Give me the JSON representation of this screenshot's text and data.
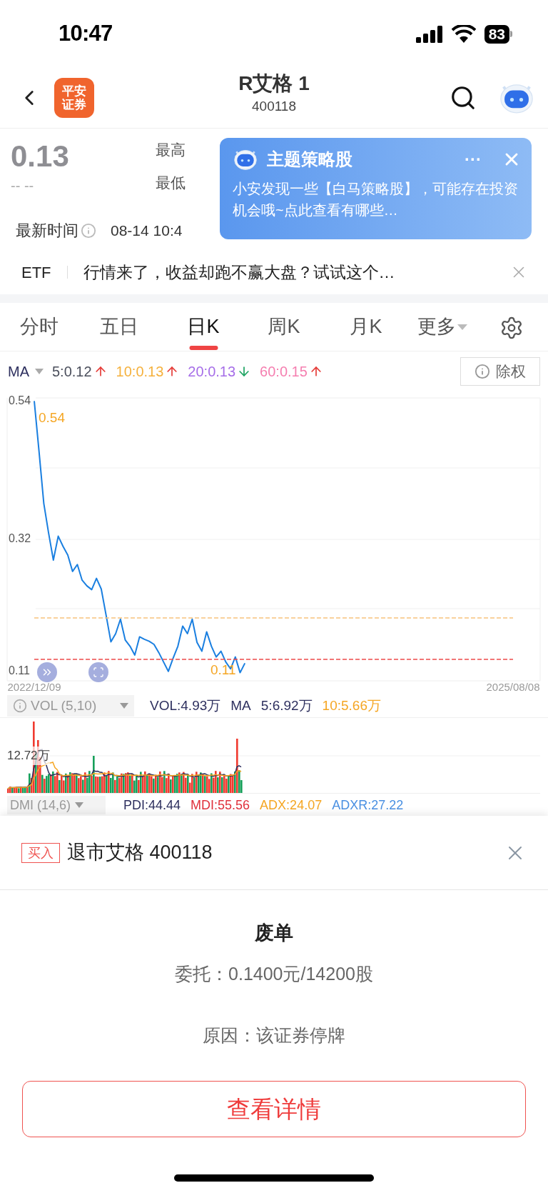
{
  "status_bar": {
    "time": "10:47",
    "battery": "83"
  },
  "header": {
    "logo_lines": [
      "平安",
      "证券"
    ],
    "title": "R艾格 1",
    "code": "400118"
  },
  "quote": {
    "price": "0.13",
    "change": "-- --",
    "labels": [
      "最高",
      "最低"
    ],
    "time_label": "最新时间",
    "time_value": "08-14 10:4"
  },
  "popup": {
    "title": "主题策略股",
    "more": "···",
    "body": "小安发现一些【白马策略股】，可能存在投资机会哦~点此查看有哪些…"
  },
  "ad": {
    "tag": "ETF",
    "text": "行情来了，收益却跑不赢大盘？试试这个…"
  },
  "tabs": [
    {
      "label": "分时",
      "selected": false
    },
    {
      "label": "五日",
      "selected": false
    },
    {
      "label": "日K",
      "selected": true
    },
    {
      "label": "周K",
      "selected": false
    },
    {
      "label": "月K",
      "selected": false
    },
    {
      "label": "更多",
      "selected": false,
      "kind": "dropdown"
    }
  ],
  "ma": {
    "label": "MA",
    "button": "除权",
    "items": [
      {
        "text": "5:0.12",
        "color": "#4b4f5c",
        "kind": "up"
      },
      {
        "text": "10:0.13",
        "color": "#f5b13d",
        "kind": "up"
      },
      {
        "text": "20:0.13",
        "color": "#a66ee8",
        "kind": "down"
      },
      {
        "text": "60:0.15",
        "color": "#f57fb0",
        "kind": "up"
      }
    ]
  },
  "chart": {
    "chart_data": {
      "type": "line",
      "ylim": [
        0.095,
        0.545
      ],
      "yticks": [
        {
          "value": 0.54,
          "label": "0.54"
        },
        {
          "value": 0.32,
          "label": "0.32"
        },
        {
          "value": 0.11,
          "label": "0.11"
        }
      ],
      "categories": [
        "2022/12/09",
        null,
        null,
        null,
        null,
        null,
        null,
        null,
        null,
        null,
        null,
        null,
        null,
        null,
        null,
        null,
        null,
        null,
        null,
        null,
        null,
        null,
        null,
        null,
        null,
        null,
        null,
        null,
        null,
        null,
        null,
        null,
        null,
        null,
        null,
        null,
        null,
        null,
        null,
        null,
        null,
        null,
        null,
        null,
        null,
        null,
        null,
        null,
        null,
        null,
        null,
        null,
        null,
        null,
        null,
        null,
        null,
        null,
        null,
        null,
        null,
        null,
        null,
        null,
        null,
        null,
        null,
        null,
        null,
        null,
        null,
        null,
        null,
        null,
        null,
        null,
        null,
        null,
        null,
        null,
        null,
        null,
        null,
        null,
        null,
        null,
        null,
        null,
        null,
        null,
        null,
        null,
        null,
        null,
        null,
        null,
        null,
        null,
        null,
        null,
        "2025/08/08"
      ],
      "series": [
        {
          "color": "#1a7fe0",
          "values": [
            0.54,
            0.46,
            0.377,
            0.33,
            0.287,
            0.325,
            0.309,
            0.295,
            0.269,
            0.28,
            0.255,
            0.246,
            0.24,
            0.258,
            0.241,
            0.2,
            0.157,
            0.17,
            0.193,
            0.16,
            0.15,
            0.136,
            0.165,
            0.161,
            0.158,
            0.153,
            0.14,
            0.125,
            0.11,
            0.131,
            0.15,
            0.182,
            0.17,
            0.193,
            0.156,
            0.142,
            0.173,
            0.15,
            0.133,
            0.142,
            0.125,
            0.114,
            0.133,
            0.108,
            0.123,
            null,
            null,
            null,
            null,
            null,
            null,
            null,
            null,
            null,
            null,
            null,
            null,
            null,
            null,
            null,
            null,
            null,
            null,
            null,
            null,
            null,
            null,
            null,
            null,
            null,
            null,
            null,
            null,
            null,
            null,
            null,
            null,
            null,
            null,
            null,
            null,
            null,
            null,
            null,
            null,
            null,
            null,
            null,
            null,
            null,
            null,
            null,
            null,
            null,
            null,
            null,
            null,
            null,
            null,
            null,
            null
          ]
        },
        {
          "color": "#f8c47e",
          "line_style": "dashed",
          "values": [
            0.195,
            0.195,
            0.195,
            0.195,
            0.195,
            0.195,
            0.195,
            0.195,
            0.195,
            0.195,
            0.195,
            0.195,
            0.195,
            0.195,
            0.195,
            0.195,
            0.195,
            0.195,
            0.195,
            0.195,
            0.195,
            0.195,
            0.195,
            0.195,
            0.195,
            0.195,
            0.195,
            0.195,
            0.195,
            0.195,
            0.195,
            0.195,
            0.195,
            0.195,
            0.195,
            0.195,
            0.195,
            0.195,
            0.195,
            0.195,
            0.195,
            0.195,
            0.195,
            0.195,
            0.195,
            0.195,
            0.195,
            0.195,
            0.195,
            0.195,
            0.195,
            0.195,
            0.195,
            0.195,
            0.195,
            0.195,
            0.195,
            0.195,
            0.195,
            0.195,
            0.195,
            0.195,
            0.195,
            0.195,
            0.195,
            0.195,
            0.195,
            0.195,
            0.195,
            0.195,
            0.195,
            0.195,
            0.195,
            0.195,
            0.195,
            0.195,
            0.195,
            0.195,
            0.195,
            0.195,
            0.195,
            0.195,
            0.195,
            0.195,
            0.195,
            0.195,
            0.195,
            0.195,
            0.195,
            0.195,
            0.195,
            0.195,
            0.195,
            0.195,
            0.195,
            0.195,
            0.195,
            0.195,
            0.195,
            0.195,
            0.195
          ]
        },
        {
          "color": "#ee4b4b",
          "line_style": "dashed",
          "values": [
            0.129,
            0.129,
            0.129,
            0.129,
            0.129,
            0.129,
            0.129,
            0.129,
            0.129,
            0.129,
            0.129,
            0.129,
            0.129,
            0.129,
            0.129,
            0.129,
            0.129,
            0.129,
            0.129,
            0.129,
            0.129,
            0.129,
            0.129,
            0.129,
            0.129,
            0.129,
            0.129,
            0.129,
            0.129,
            0.129,
            0.129,
            0.129,
            0.129,
            0.129,
            0.129,
            0.129,
            0.129,
            0.129,
            0.129,
            0.129,
            0.129,
            0.129,
            0.129,
            0.129,
            0.129,
            0.129,
            0.129,
            0.129,
            0.129,
            0.129,
            0.129,
            0.129,
            0.129,
            0.129,
            0.129,
            0.129,
            0.129,
            0.129,
            0.129,
            0.129,
            0.129,
            0.129,
            0.129,
            0.129,
            0.129,
            0.129,
            0.129,
            0.129,
            0.129,
            0.129,
            0.129,
            0.129,
            0.129,
            0.129,
            0.129,
            0.129,
            0.129,
            0.129,
            0.129,
            0.129,
            0.129,
            0.129,
            0.129,
            0.129,
            0.129,
            0.129,
            0.129,
            0.129,
            0.129,
            0.129,
            0.129,
            0.129,
            0.129,
            0.129,
            0.129,
            0.129,
            0.129,
            0.129,
            0.129,
            0.129,
            0.129
          ]
        }
      ],
      "annotations": [
        "0.54",
        "0.11"
      ]
    }
  },
  "volume": {
    "label": "VOL (5,10)",
    "scale_label": "12.72万",
    "items": [
      {
        "text": "VOL:4.93万",
        "color": "#2d2f5e"
      },
      {
        "text": "MA",
        "color": "#2d2f5e"
      },
      {
        "text": "5:6.92万",
        "color": "#2d2f5e"
      },
      {
        "text": "10:5.66万",
        "color": "#f5a623"
      }
    ]
  },
  "dmi": {
    "label": "DMI (14,6)",
    "items": [
      {
        "text": "PDI:44.44",
        "color": "#2d2f5e"
      },
      {
        "text": "MDI:55.56",
        "color": "#e0313c"
      },
      {
        "text": "ADX:24.07",
        "color": "#f5a623"
      },
      {
        "text": "ADXR:27.22",
        "color": "#4a90e2"
      }
    ]
  },
  "order_sheet": {
    "side": "买入",
    "title": "退市艾格 400118",
    "status": "废单",
    "order": "委托：0.1400元/14200股",
    "reason": "原因：该证券停牌",
    "button": "查看详情"
  }
}
